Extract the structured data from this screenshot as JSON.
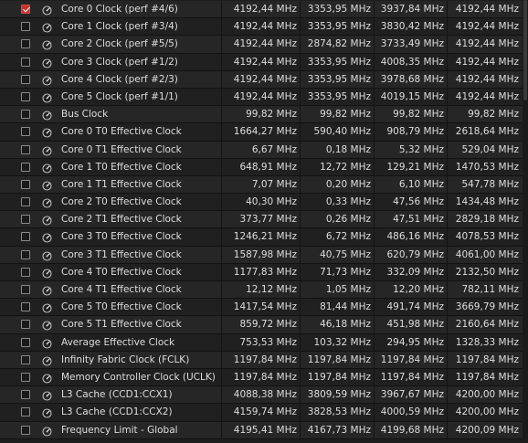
{
  "rows": [
    {
      "checked": true,
      "name": "Core 0 Clock (perf #4/6)",
      "current": "4192,44 MHz",
      "min": "3353,95 MHz",
      "avg": "3937,84 MHz",
      "max": "4192,44 MHz"
    },
    {
      "checked": false,
      "name": "Core 1 Clock (perf #3/4)",
      "current": "4192,44 MHz",
      "min": "3353,95 MHz",
      "avg": "3830,42 MHz",
      "max": "4192,44 MHz"
    },
    {
      "checked": false,
      "name": "Core 2 Clock (perf #5/5)",
      "current": "4192,44 MHz",
      "min": "2874,82 MHz",
      "avg": "3733,49 MHz",
      "max": "4192,44 MHz"
    },
    {
      "checked": false,
      "name": "Core 3 Clock (perf #1/2)",
      "current": "4192,44 MHz",
      "min": "3353,95 MHz",
      "avg": "4008,35 MHz",
      "max": "4192,44 MHz"
    },
    {
      "checked": false,
      "name": "Core 4 Clock (perf #2/3)",
      "current": "4192,44 MHz",
      "min": "3353,95 MHz",
      "avg": "3978,68 MHz",
      "max": "4192,44 MHz"
    },
    {
      "checked": false,
      "name": "Core 5 Clock (perf #1/1)",
      "current": "4192,44 MHz",
      "min": "3353,95 MHz",
      "avg": "4019,15 MHz",
      "max": "4192,44 MHz"
    },
    {
      "checked": false,
      "name": "Bus Clock",
      "current": "99,82 MHz",
      "min": "99,82 MHz",
      "avg": "99,82 MHz",
      "max": "99,82 MHz"
    },
    {
      "checked": false,
      "name": "Core 0 T0 Effective Clock",
      "current": "1664,27 MHz",
      "min": "590,40 MHz",
      "avg": "908,79 MHz",
      "max": "2618,64 MHz"
    },
    {
      "checked": false,
      "name": "Core 0 T1 Effective Clock",
      "current": "6,67 MHz",
      "min": "0,18 MHz",
      "avg": "5,32 MHz",
      "max": "529,04 MHz"
    },
    {
      "checked": false,
      "name": "Core 1 T0 Effective Clock",
      "current": "648,91 MHz",
      "min": "12,72 MHz",
      "avg": "129,21 MHz",
      "max": "1470,53 MHz"
    },
    {
      "checked": false,
      "name": "Core 1 T1 Effective Clock",
      "current": "7,07 MHz",
      "min": "0,20 MHz",
      "avg": "6,10 MHz",
      "max": "547,78 MHz"
    },
    {
      "checked": false,
      "name": "Core 2 T0 Effective Clock",
      "current": "40,30 MHz",
      "min": "0,33 MHz",
      "avg": "47,56 MHz",
      "max": "1434,48 MHz"
    },
    {
      "checked": false,
      "name": "Core 2 T1 Effective Clock",
      "current": "373,77 MHz",
      "min": "0,26 MHz",
      "avg": "47,51 MHz",
      "max": "2829,18 MHz"
    },
    {
      "checked": false,
      "name": "Core 3 T0 Effective Clock",
      "current": "1246,21 MHz",
      "min": "6,72 MHz",
      "avg": "486,16 MHz",
      "max": "4078,53 MHz"
    },
    {
      "checked": false,
      "name": "Core 3 T1 Effective Clock",
      "current": "1587,98 MHz",
      "min": "40,75 MHz",
      "avg": "620,79 MHz",
      "max": "4061,00 MHz"
    },
    {
      "checked": false,
      "name": "Core 4 T0 Effective Clock",
      "current": "1177,83 MHz",
      "min": "71,73 MHz",
      "avg": "332,09 MHz",
      "max": "2132,50 MHz"
    },
    {
      "checked": false,
      "name": "Core 4 T1 Effective Clock",
      "current": "12,12 MHz",
      "min": "1,05 MHz",
      "avg": "12,20 MHz",
      "max": "782,11 MHz"
    },
    {
      "checked": false,
      "name": "Core 5 T0 Effective Clock",
      "current": "1417,54 MHz",
      "min": "81,44 MHz",
      "avg": "491,74 MHz",
      "max": "3669,79 MHz"
    },
    {
      "checked": false,
      "name": "Core 5 T1 Effective Clock",
      "current": "859,72 MHz",
      "min": "46,18 MHz",
      "avg": "451,98 MHz",
      "max": "2160,64 MHz"
    },
    {
      "checked": false,
      "name": "Average Effective Clock",
      "current": "753,53 MHz",
      "min": "103,32 MHz",
      "avg": "294,95 MHz",
      "max": "1328,33 MHz"
    },
    {
      "checked": false,
      "name": "Infinity Fabric Clock (FCLK)",
      "current": "1197,84 MHz",
      "min": "1197,84 MHz",
      "avg": "1197,84 MHz",
      "max": "1197,84 MHz"
    },
    {
      "checked": false,
      "name": "Memory Controller Clock (UCLK)",
      "current": "1197,84 MHz",
      "min": "1197,84 MHz",
      "avg": "1197,84 MHz",
      "max": "1197,84 MHz"
    },
    {
      "checked": false,
      "name": "L3 Cache (CCD1:CCX1)",
      "current": "4088,38 MHz",
      "min": "3809,59 MHz",
      "avg": "3967,67 MHz",
      "max": "4200,00 MHz"
    },
    {
      "checked": false,
      "name": "L3 Cache (CCD1:CCX2)",
      "current": "4159,74 MHz",
      "min": "3828,53 MHz",
      "avg": "4000,59 MHz",
      "max": "4200,00 MHz"
    },
    {
      "checked": false,
      "name": "Frequency Limit - Global",
      "current": "4195,41 MHz",
      "min": "4167,73 MHz",
      "avg": "4199,68 MHz",
      "max": "4200,09 MHz"
    }
  ],
  "icons": {
    "row_icon": "gauge-icon",
    "checkbox_checked_color": "#c8322d"
  }
}
